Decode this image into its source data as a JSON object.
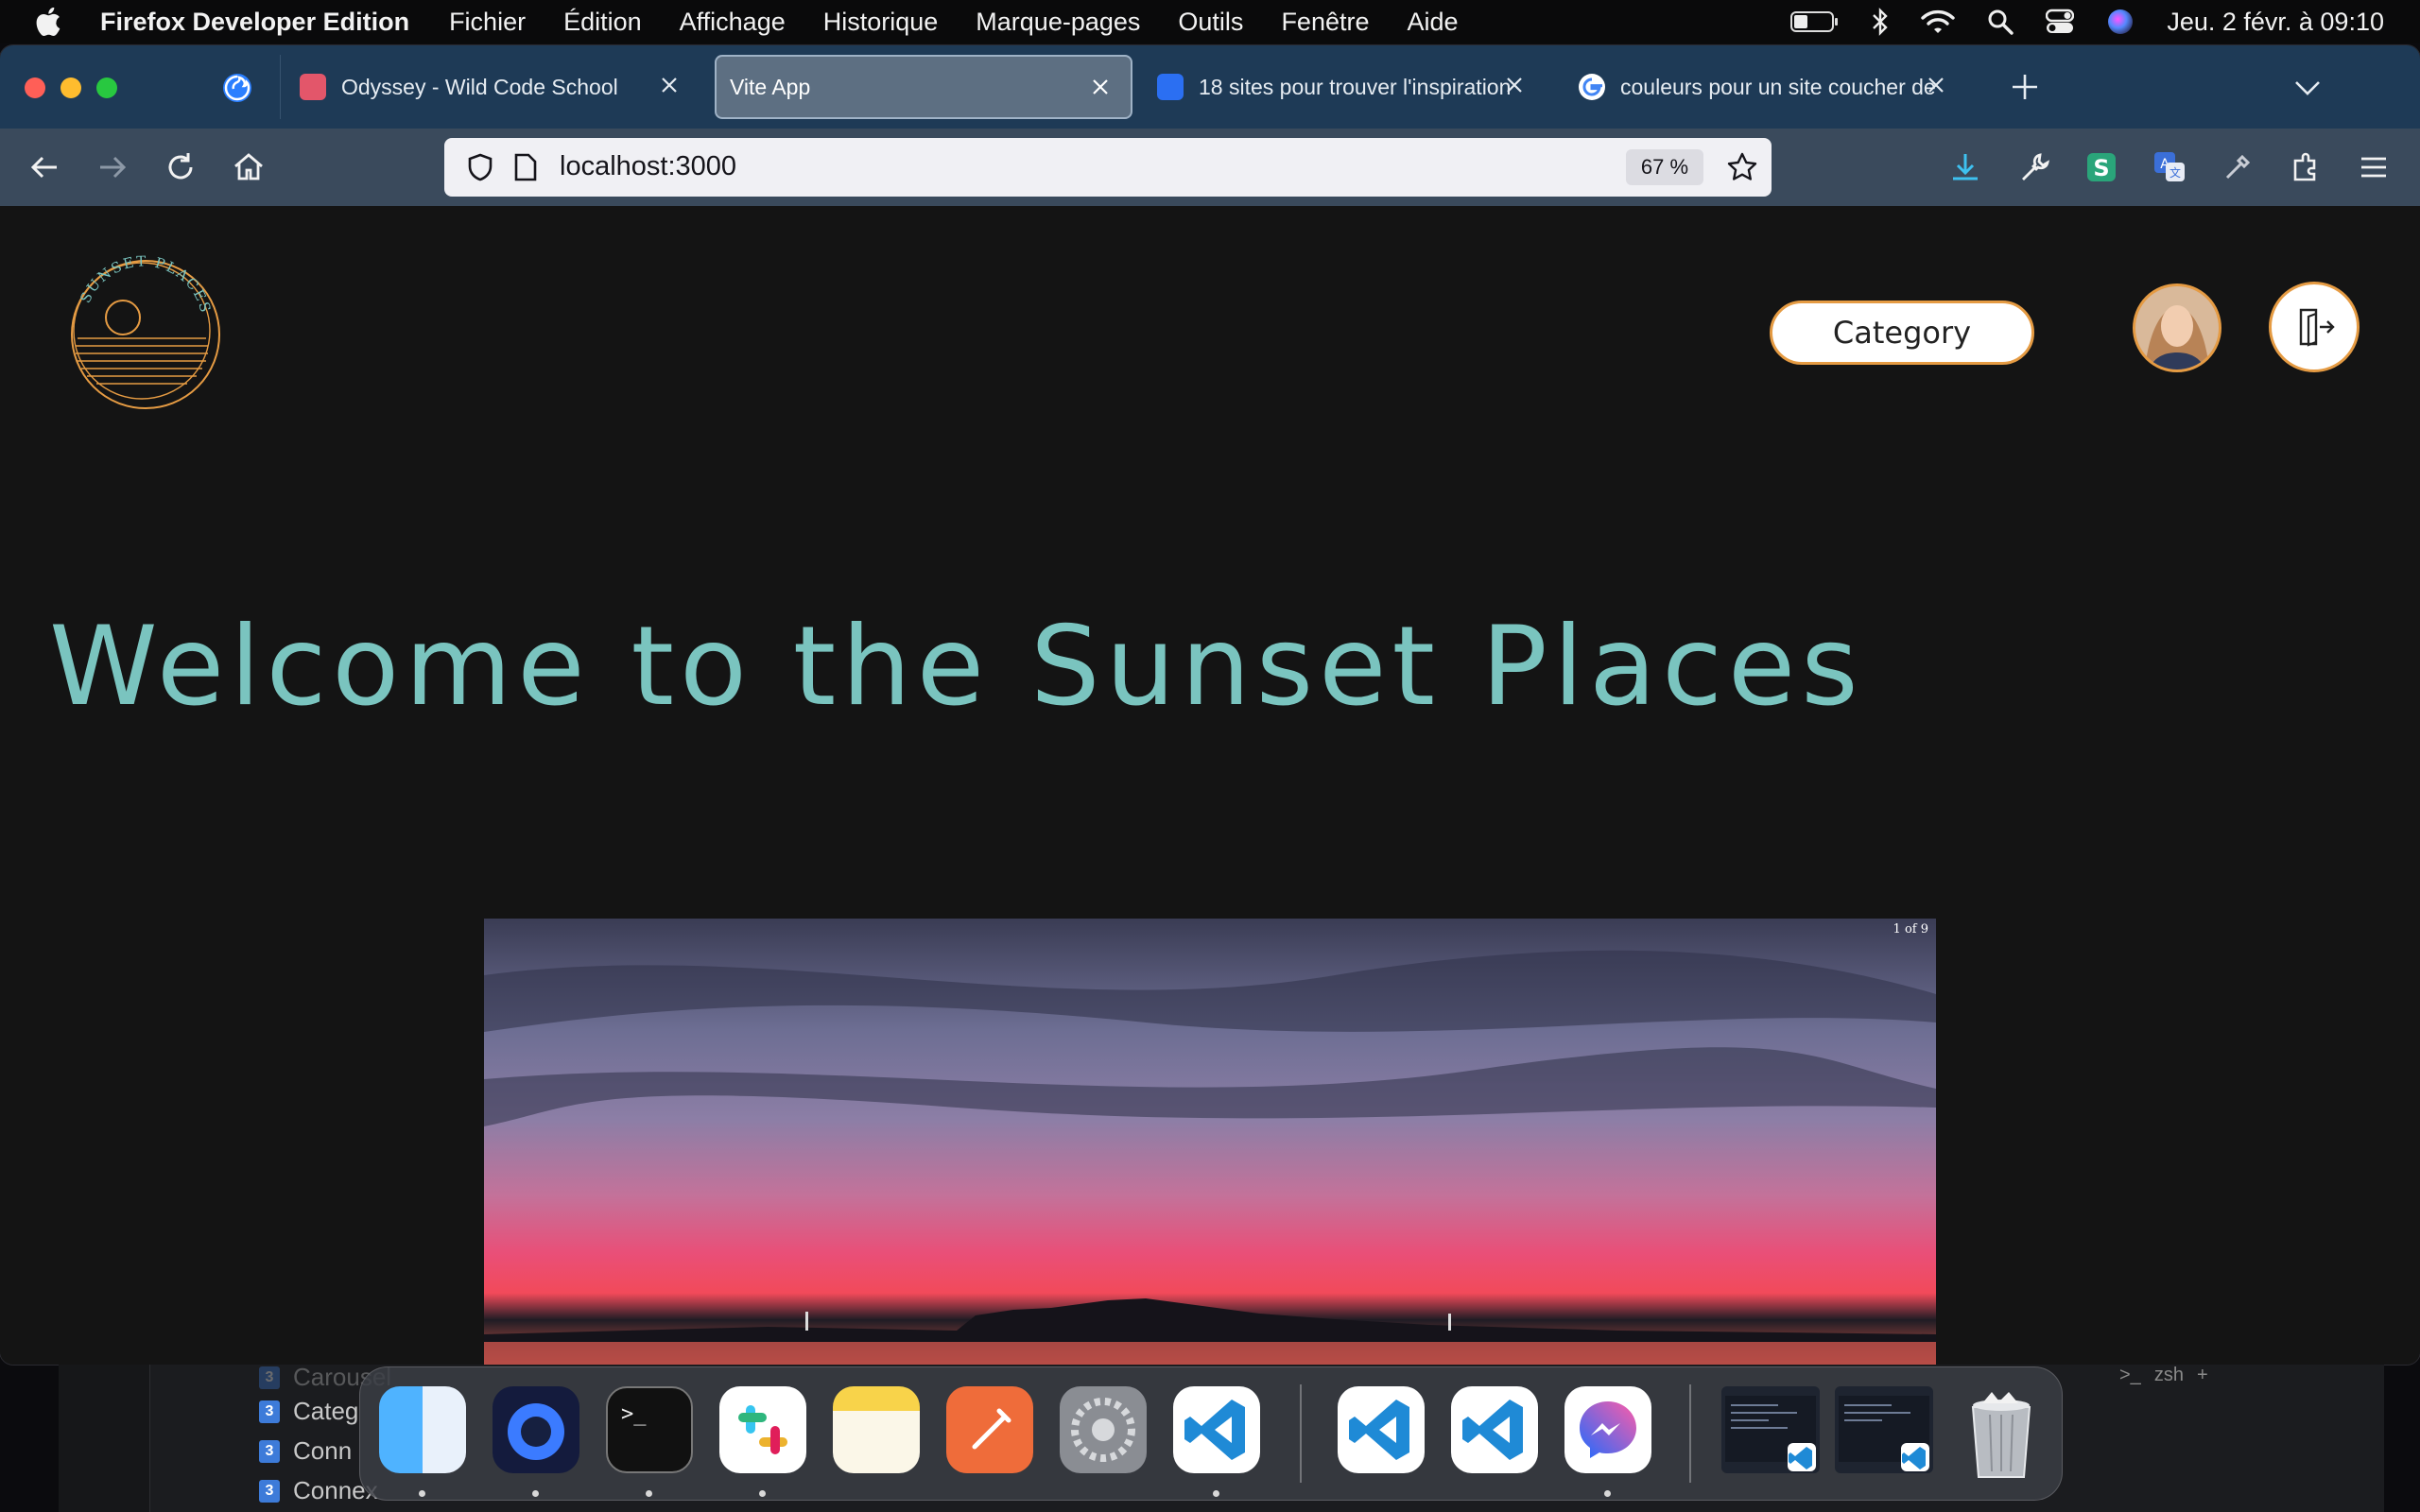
{
  "menubar": {
    "app_name": "Firefox Developer Edition",
    "menus": [
      "Fichier",
      "Édition",
      "Affichage",
      "Historique",
      "Marque-pages",
      "Outils",
      "Fenêtre",
      "Aide"
    ],
    "datetime": "Jeu. 2 févr. à  09:10"
  },
  "browser": {
    "tabs": [
      {
        "title": "Odyssey - Wild Code School",
        "active": false
      },
      {
        "title": "Vite App",
        "active": true
      },
      {
        "title": "18 sites pour trouver l'inspiration",
        "active": false
      },
      {
        "title": "couleurs pour un site coucher de",
        "active": false
      }
    ],
    "url": "localhost:3000",
    "zoom": "67 %"
  },
  "page": {
    "logo_text": "SUNSET PLACES",
    "category_label": "Category",
    "headline": "Welcome to the Sunset Places",
    "carousel_counter": "1 of 9",
    "colors": {
      "accent": "#e59b43",
      "headline": "#7ac4bf",
      "background": "#141414"
    }
  },
  "background_terminal": {
    "files": [
      "Carousel",
      "Categ",
      "Conn",
      "Connex"
    ],
    "shell": "zsh"
  },
  "dock": {
    "apps": [
      "finder-icon",
      "firefox-developer-icon",
      "terminal-icon",
      "slack-icon",
      "notes-icon",
      "postman-icon",
      "system-settings-icon",
      "vscode-icon",
      "vscode-icon",
      "vscode-icon",
      "messenger-icon",
      "window-thumbnail",
      "window-thumbnail",
      "trash-icon"
    ]
  }
}
